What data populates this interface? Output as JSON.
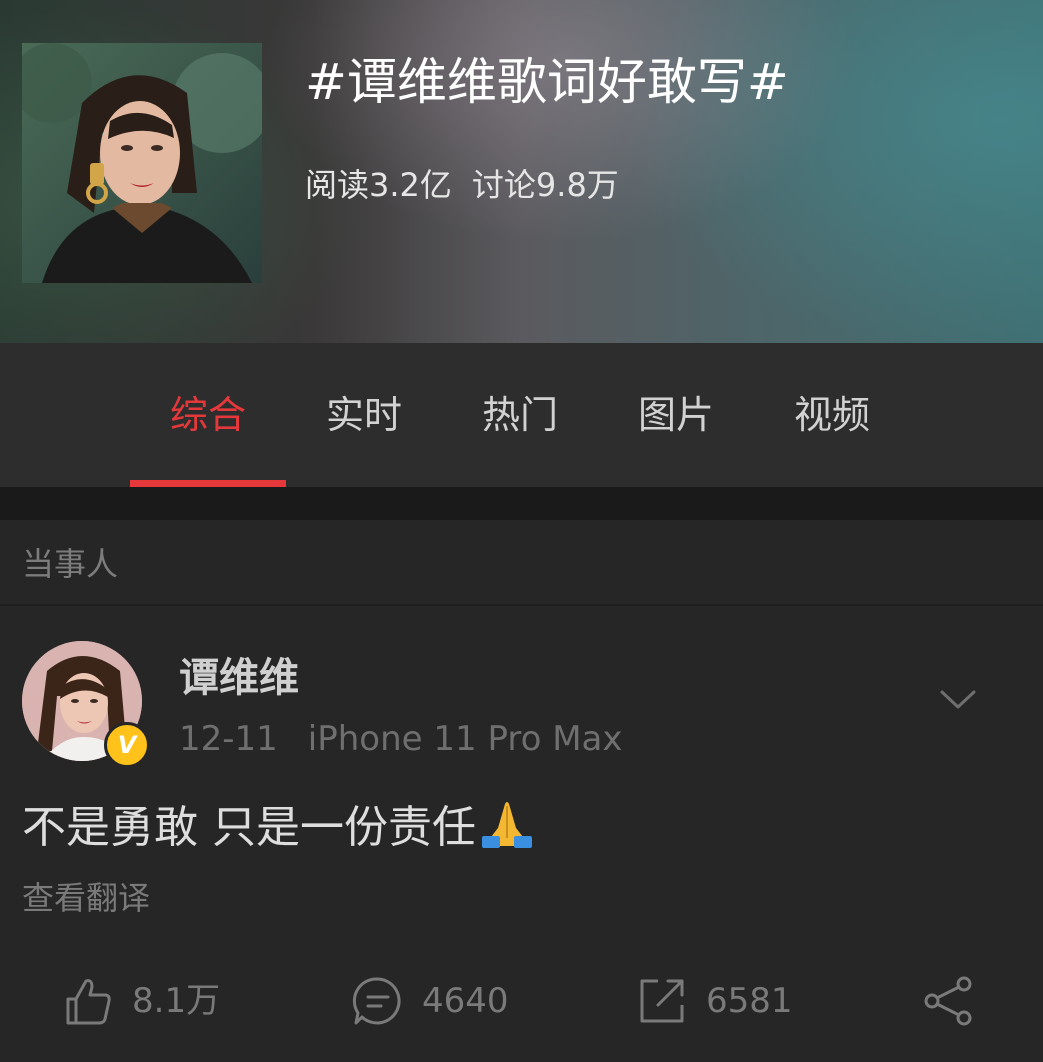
{
  "header": {
    "title": "#谭维维歌词好敢写#",
    "reads": "阅读3.2亿",
    "discussions": "讨论9.8万"
  },
  "tabs": [
    {
      "label": "综合",
      "active": true
    },
    {
      "label": "实时",
      "active": false
    },
    {
      "label": "热门",
      "active": false
    },
    {
      "label": "图片",
      "active": false
    },
    {
      "label": "视频",
      "active": false
    }
  ],
  "section": {
    "label": "当事人"
  },
  "post": {
    "author": "谭维维",
    "verified_badge": "V",
    "date": "12-11",
    "device": "iPhone 11 Pro Max",
    "text": "不是勇敢 只是一份责任",
    "emoji": "folded-hands",
    "translate_label": "查看翻译"
  },
  "actions": {
    "likes": "8.1万",
    "comments": "4640",
    "reposts": "6581"
  },
  "colors": {
    "accent": "#e5383b",
    "background": "#262626",
    "verified": "#ffc21a"
  }
}
